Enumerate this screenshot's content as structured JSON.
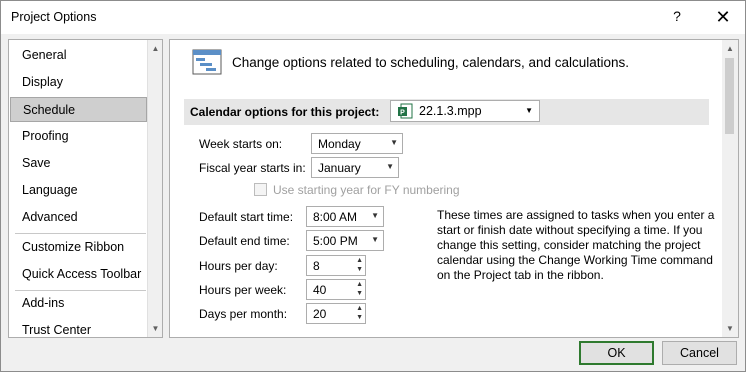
{
  "window": {
    "title": "Project Options",
    "help_label": "?",
    "close_label": "✕"
  },
  "nav": {
    "items": [
      {
        "label": "General"
      },
      {
        "label": "Display"
      },
      {
        "label": "Schedule",
        "selected": true
      },
      {
        "label": "Proofing"
      },
      {
        "label": "Save"
      },
      {
        "label": "Language"
      },
      {
        "label": "Advanced"
      },
      {
        "label": "Customize Ribbon"
      },
      {
        "label": "Quick Access Toolbar"
      },
      {
        "label": "Add-ins"
      },
      {
        "label": "Trust Center"
      }
    ]
  },
  "main": {
    "header": "Change options related to scheduling, calendars, and calculations.",
    "section_label": "Calendar options for this project:",
    "project_file": "22.1.3.mpp",
    "week_starts_label": "Week starts on:",
    "week_starts_value": "Monday",
    "fiscal_year_label": "Fiscal year starts in:",
    "fiscal_year_value": "January",
    "use_starting_year_label": "Use starting year for FY numbering",
    "use_starting_year_checked": false,
    "default_start_label": "Default start time:",
    "default_start_value": "8:00 AM",
    "default_end_label": "Default end time:",
    "default_end_value": "5:00 PM",
    "hours_per_day_label": "Hours per day:",
    "hours_per_day_value": "8",
    "hours_per_week_label": "Hours per week:",
    "hours_per_week_value": "40",
    "days_per_month_label": "Days per month:",
    "days_per_month_value": "20",
    "note": "These times are assigned to tasks when you enter a start or finish date without specifying a time. If you change this setting, consider matching the project calendar using the Change Working Time command on the Project tab in the ribbon."
  },
  "buttons": {
    "ok": "OK",
    "cancel": "Cancel"
  },
  "icons": {
    "up": "▲",
    "down": "▼"
  },
  "colors": {
    "ok_border": "#2f7a2f",
    "project_icon": "#217346",
    "selection": "#cfcfcf"
  }
}
